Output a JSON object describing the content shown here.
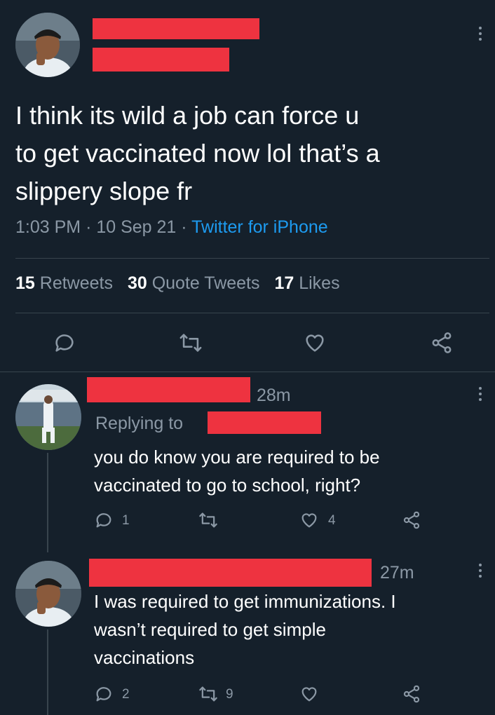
{
  "main_tweet": {
    "text_lines": [
      "I think its wild a job can force u",
      "to get vaccinated now lol that’s a",
      "slippery slope fr"
    ],
    "time": "1:03 PM",
    "date": "10 Sep 21",
    "source": "Twitter for iPhone",
    "sep": "·",
    "stats": {
      "retweets_count": "15",
      "retweets_label": "Retweets",
      "quotes_count": "30",
      "quotes_label": "Quote Tweets",
      "likes_count": "17",
      "likes_label": "Likes"
    }
  },
  "reply1": {
    "time": "28m",
    "replying_to_label": "Replying to",
    "text_lines": [
      "you do know you are required to be",
      "vaccinated to go to school, right?"
    ],
    "reply_count": "1",
    "like_count": "4"
  },
  "reply2": {
    "time": "27m",
    "text_lines": [
      "I was required to get immunizations. I",
      "wasn’t required to get simple",
      "vaccinations"
    ],
    "reply_count": "2",
    "retweet_count": "9"
  },
  "colors": {
    "background": "#15202b",
    "muted": "#8b98a5",
    "link": "#1d9bf0",
    "redaction": "#ee3340",
    "divider": "#38444d"
  },
  "icons": [
    "reply-icon",
    "retweet-icon",
    "like-icon",
    "share-icon",
    "more-icon"
  ]
}
